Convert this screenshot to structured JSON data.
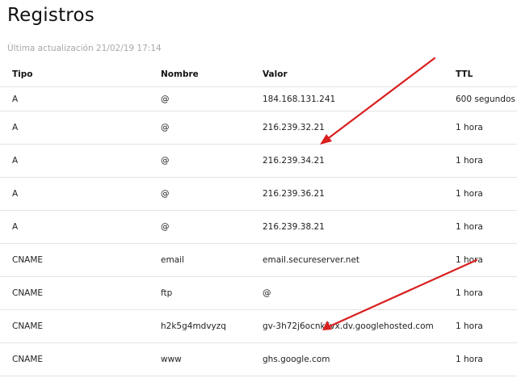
{
  "page": {
    "title": "Registros",
    "last_updated": "Última actualización 21/02/19 17:14"
  },
  "table": {
    "headers": {
      "type": "Tipo",
      "name": "Nombre",
      "value": "Valor",
      "ttl": "TTL"
    },
    "rows": [
      {
        "type": "A",
        "name": "@",
        "value": "184.168.131.241",
        "ttl": "600 segundos"
      },
      {
        "type": "A",
        "name": "@",
        "value": "216.239.32.21",
        "ttl": "1 hora"
      },
      {
        "type": "A",
        "name": "@",
        "value": "216.239.34.21",
        "ttl": "1 hora"
      },
      {
        "type": "A",
        "name": "@",
        "value": "216.239.36.21",
        "ttl": "1 hora"
      },
      {
        "type": "A",
        "name": "@",
        "value": "216.239.38.21",
        "ttl": "1 hora"
      },
      {
        "type": "CNAME",
        "name": "email",
        "value": "email.secureserver.net",
        "ttl": "1 hora"
      },
      {
        "type": "CNAME",
        "name": "ftp",
        "value": "@",
        "ttl": "1 hora"
      },
      {
        "type": "CNAME",
        "name": "h2k5g4mdvyzq",
        "value": "gv-3h72j6ocnklivx.dv.googlehosted.com",
        "ttl": "1 hora"
      },
      {
        "type": "CNAME",
        "name": "www",
        "value": "ghs.google.com",
        "ttl": "1 hora"
      }
    ]
  },
  "colors": {
    "annotation_arrow": "#d91e1e"
  }
}
